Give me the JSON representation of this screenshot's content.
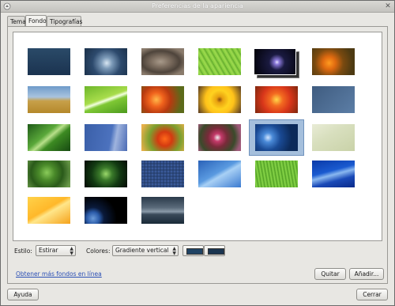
{
  "window": {
    "title": "Preferencias de la apariencia"
  },
  "tabs": [
    {
      "label": "Tema",
      "active": false
    },
    {
      "label": "Fondo",
      "active": true
    },
    {
      "label": "Tipografías",
      "active": false
    }
  ],
  "wallpapers": [
    {
      "name": "dark-teal-gradient",
      "selected": false
    },
    {
      "name": "water-drop",
      "selected": false
    },
    {
      "name": "wood-carving",
      "selected": false
    },
    {
      "name": "green-leaf-macro",
      "selected": false
    },
    {
      "name": "comet-night",
      "selected": false
    },
    {
      "name": "orange-flower-bee",
      "selected": false
    },
    {
      "name": "wheat-field",
      "selected": false
    },
    {
      "name": "green-swoosh",
      "selected": false
    },
    {
      "name": "orange-flowers",
      "selected": false
    },
    {
      "name": "yellow-daisy",
      "selected": false
    },
    {
      "name": "red-flower-bloom",
      "selected": false
    },
    {
      "name": "blue-grey-dots",
      "selected": false
    },
    {
      "name": "green-leaf-veins",
      "selected": false
    },
    {
      "name": "blue-curves",
      "selected": false
    },
    {
      "name": "orange-red-flowers",
      "selected": false
    },
    {
      "name": "pink-flowers",
      "selected": false
    },
    {
      "name": "blue-starburst",
      "selected": true
    },
    {
      "name": "pale-green-texture",
      "selected": false
    },
    {
      "name": "green-foliage",
      "selected": false
    },
    {
      "name": "dark-leaf-bokeh",
      "selected": false
    },
    {
      "name": "blue-texture",
      "selected": false
    },
    {
      "name": "blue-wave",
      "selected": false
    },
    {
      "name": "grass",
      "selected": false
    },
    {
      "name": "deep-blue-wave",
      "selected": false
    },
    {
      "name": "orange-glow",
      "selected": false
    },
    {
      "name": "earth-from-space",
      "selected": false
    },
    {
      "name": "stormy-sea",
      "selected": false
    }
  ],
  "controls": {
    "style_label": "Estilo:",
    "style_value": "Estirar",
    "colors_label": "Colores:",
    "colors_value": "Gradiente vertical",
    "primary_color": "#1f4364",
    "secondary_color": "#1a3550"
  },
  "actions": {
    "more_link": "Obtener más fondos en línea",
    "remove_label": "Quitar",
    "add_label": "Añadir..."
  },
  "footer": {
    "help_label": "Ayuda",
    "close_label": "Cerrar"
  }
}
